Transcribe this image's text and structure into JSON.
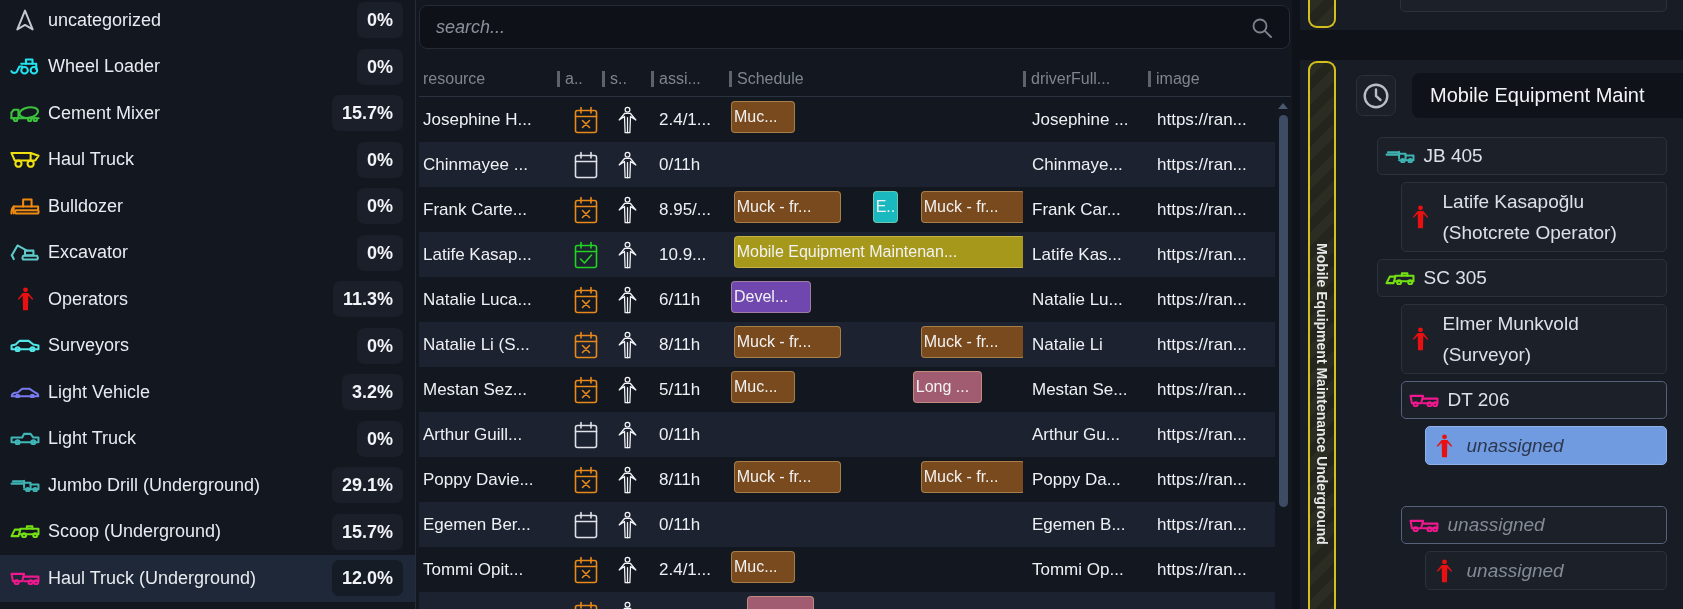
{
  "categories": [
    {
      "kind": "arrow",
      "label": "uncategorized",
      "color": "#c4c8cf",
      "percent": "0%",
      "selected": false
    },
    {
      "kind": "loader",
      "label": "Wheel Loader",
      "color": "#22e4ee",
      "percent": "0%",
      "selected": false
    },
    {
      "kind": "mixer",
      "label": "Cement Mixer",
      "color": "#3cc23c",
      "percent": "15.7%",
      "selected": false
    },
    {
      "kind": "truck",
      "label": "Haul Truck",
      "color": "#f0e010",
      "percent": "0%",
      "selected": false
    },
    {
      "kind": "dozer",
      "label": "Bulldozer",
      "color": "#f0890f",
      "percent": "0%",
      "selected": false
    },
    {
      "kind": "excavator",
      "label": "Excavator",
      "color": "#5ecaca",
      "percent": "0%",
      "selected": false
    },
    {
      "kind": "operator",
      "label": "Operators",
      "color": "#e81010",
      "percent": "11.3%",
      "selected": false
    },
    {
      "kind": "car",
      "label": "Surveyors",
      "color": "#52e6e6",
      "percent": "0%",
      "selected": false
    },
    {
      "kind": "sedan",
      "label": "Light Vehicle",
      "color": "#7a7af0",
      "percent": "3.2%",
      "selected": false
    },
    {
      "kind": "pickup",
      "label": "Light Truck",
      "color": "#40b8b8",
      "percent": "0%",
      "selected": false
    },
    {
      "kind": "drill",
      "label": "Jumbo Drill (Underground)",
      "color": "#3fb2b2",
      "percent": "29.1%",
      "selected": false
    },
    {
      "kind": "scoop",
      "label": "Scoop (Underground)",
      "color": "#74e014",
      "percent": "15.7%",
      "selected": false
    },
    {
      "kind": "dumper",
      "label": "Haul Truck (Underground)",
      "color": "#f0188e",
      "percent": "12.0%",
      "selected": true
    }
  ],
  "search": {
    "placeholder": "search..."
  },
  "table": {
    "columns": [
      "resource",
      "a..",
      "s..",
      "assi...",
      "Schedule",
      "driverFull...",
      "image"
    ],
    "rows": [
      {
        "kind": "crossed",
        "resource": "Josephine H...",
        "assigned_hours": "2.4/1...",
        "schedule": [
          {
            "label": "Muc...",
            "color": "#7a4a1f"
          }
        ],
        "driver": "Josephine ...",
        "image": "https://ran..."
      },
      {
        "kind": "empty",
        "resource": "Chinmayee ...",
        "assigned_hours": "0/11h",
        "driver": "Chinmaye...",
        "image": "https://ran..."
      },
      {
        "kind": "crossed",
        "resource": "Frank Carte...",
        "assigned_hours": "8.95/...",
        "schedule": [
          {
            "label": "Muck - fr...",
            "color": "#7a4a1f"
          },
          {
            "label": "E..",
            "color": "#19b9bf"
          },
          {
            "label": "Muck - fr...",
            "color": "#7a4a1f"
          }
        ],
        "driver": "Frank Car...",
        "image": "https://ran..."
      },
      {
        "kind": "checked",
        "resource": "Latife Kasap...",
        "assigned_hours": "10.9...",
        "schedule": [
          {
            "label": "Mobile Equipment Maintenan...",
            "color": "#a6981a"
          }
        ],
        "driver": "Latife Kas...",
        "image": "https://ran..."
      },
      {
        "kind": "crossed",
        "resource": "Natalie Luca...",
        "assigned_hours": "6/11h",
        "schedule": [
          {
            "label": "Devel...",
            "color": "#6f47ae"
          }
        ],
        "driver": "Natalie Lu...",
        "image": "https://ran..."
      },
      {
        "kind": "crossed",
        "resource": "Natalie Li (S...",
        "assigned_hours": "8/11h",
        "schedule": [
          {
            "label": "Muck - fr...",
            "color": "#7a4a1f"
          },
          {
            "label": "Muck - fr...",
            "color": "#7a4a1f"
          }
        ],
        "driver": "Natalie Li",
        "image": "https://ran..."
      },
      {
        "kind": "crossed",
        "resource": "Mestan Sez...",
        "assigned_hours": "5/11h",
        "schedule": [
          {
            "label": "Muc...",
            "color": "#7a4a1f"
          },
          {
            "label": "Long ...",
            "color": "#a15c72"
          }
        ],
        "driver": "Mestan Se...",
        "image": "https://ran..."
      },
      {
        "kind": "empty",
        "resource": "Arthur Guill...",
        "assigned_hours": "0/11h",
        "driver": "Arthur Gu...",
        "image": "https://ran..."
      },
      {
        "kind": "crossed",
        "resource": "Poppy Davie...",
        "assigned_hours": "8/11h",
        "schedule": [
          {
            "label": "Muck - fr...",
            "color": "#7a4a1f"
          },
          {
            "label": "Muck - fr...",
            "color": "#7a4a1f"
          }
        ],
        "driver": "Poppy Da...",
        "image": "https://ran..."
      },
      {
        "kind": "empty",
        "resource": "Egemen Ber...",
        "assigned_hours": "0/11h",
        "driver": "Egemen B...",
        "image": "https://ran..."
      },
      {
        "kind": "crossed",
        "resource": "Tommi Opit...",
        "assigned_hours": "2.4/1...",
        "schedule": [
          {
            "label": "Muc...",
            "color": "#7a4a1f"
          }
        ],
        "driver": "Tommi Op...",
        "image": "https://ran..."
      },
      {
        "kind": "crossed",
        "schedule": [
          {
            "color": "#a15c72"
          }
        ]
      }
    ]
  },
  "schedule_group": {
    "band_label": "Mobile Equipment Maintenance Underground",
    "title": "Mobile Equipment Maint",
    "nodes": [
      {
        "kind": "drill",
        "label": "JB 405",
        "color": "#3fb2b2",
        "assigned": true,
        "selected": false,
        "children": [
          {
            "kind": "operator",
            "label": "Latife Kasapoğlu (Shotcrete Operator)",
            "color": "#e81010",
            "assigned": true,
            "selected": false
          }
        ]
      },
      {
        "kind": "scoop",
        "label": "SC 305",
        "color": "#74e014",
        "assigned": true,
        "selected": false,
        "children": [
          {
            "kind": "operator",
            "label": "Elmer Munkvold (Surveyor)",
            "color": "#e81010",
            "assigned": true,
            "selected": false
          },
          {
            "kind": "dumper",
            "label": "DT 206",
            "color": "#f0188e",
            "assigned": true,
            "selected": false,
            "children": [
              {
                "kind": "operator",
                "label": "unassigned",
                "color": "#e81010",
                "assigned": false,
                "selected": true
              }
            ]
          },
          {
            "kind": "dumper",
            "label": "unassigned",
            "color": "#f0188e",
            "assigned": false,
            "selected": false,
            "children": [
              {
                "kind": "operator",
                "label": "unassigned",
                "color": "#e81010",
                "assigned": false,
                "selected": false
              }
            ]
          }
        ]
      }
    ]
  }
}
